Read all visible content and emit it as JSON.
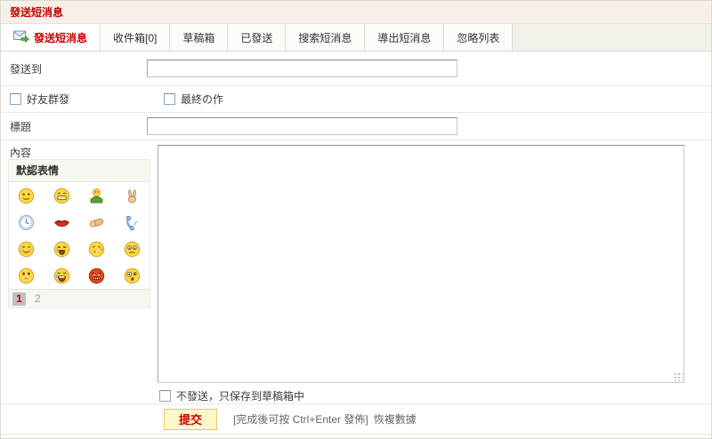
{
  "header": {
    "title": "發送短消息"
  },
  "tabs": [
    {
      "label": "發送短消息",
      "active": true
    },
    {
      "label": "收件箱[0]",
      "active": false
    },
    {
      "label": "草稿箱",
      "active": false
    },
    {
      "label": "已發送",
      "active": false
    },
    {
      "label": "搜索短消息",
      "active": false
    },
    {
      "label": "導出短消息",
      "active": false
    },
    {
      "label": "忽略列表",
      "active": false
    }
  ],
  "form": {
    "send_to_label": "發送到",
    "send_to_value": "",
    "friend_mass_label": "好友群發",
    "final_work_label": "最終の作",
    "title_label": "標題",
    "title_value": "",
    "content_label": "內容",
    "content_value": "",
    "draft_only_label": "不發送，只保存到草稿箱中",
    "submit_label": "提交",
    "submit_hint": "[完成後可按 Ctrl+Enter 發佈]",
    "restore_label": "恢複數據"
  },
  "emoticon_panel": {
    "header": "默認表情",
    "emoticons": [
      "smirk-smiley",
      "grin-smiley",
      "hug-smiley",
      "victory-hand",
      "clock",
      "kiss-lips",
      "handshake",
      "telephone",
      "blush-smiley",
      "crying-smiley",
      "sick-smiley",
      "worried-smiley",
      "smile-smiley",
      "laughing-smiley",
      "angry-smiley",
      "shocked-smiley"
    ],
    "pages": [
      "1",
      "2"
    ],
    "current_page": "1"
  },
  "colors": {
    "accent_red": "#cc0000",
    "header_bg": "#f7f0ea",
    "tabstrip_bg": "#f1f1ea",
    "button_bg": "#fff7cc",
    "button_border": "#eec463",
    "pagination_current_bg": "#c0c0c0",
    "panel_bg": "#f7f7f2"
  }
}
